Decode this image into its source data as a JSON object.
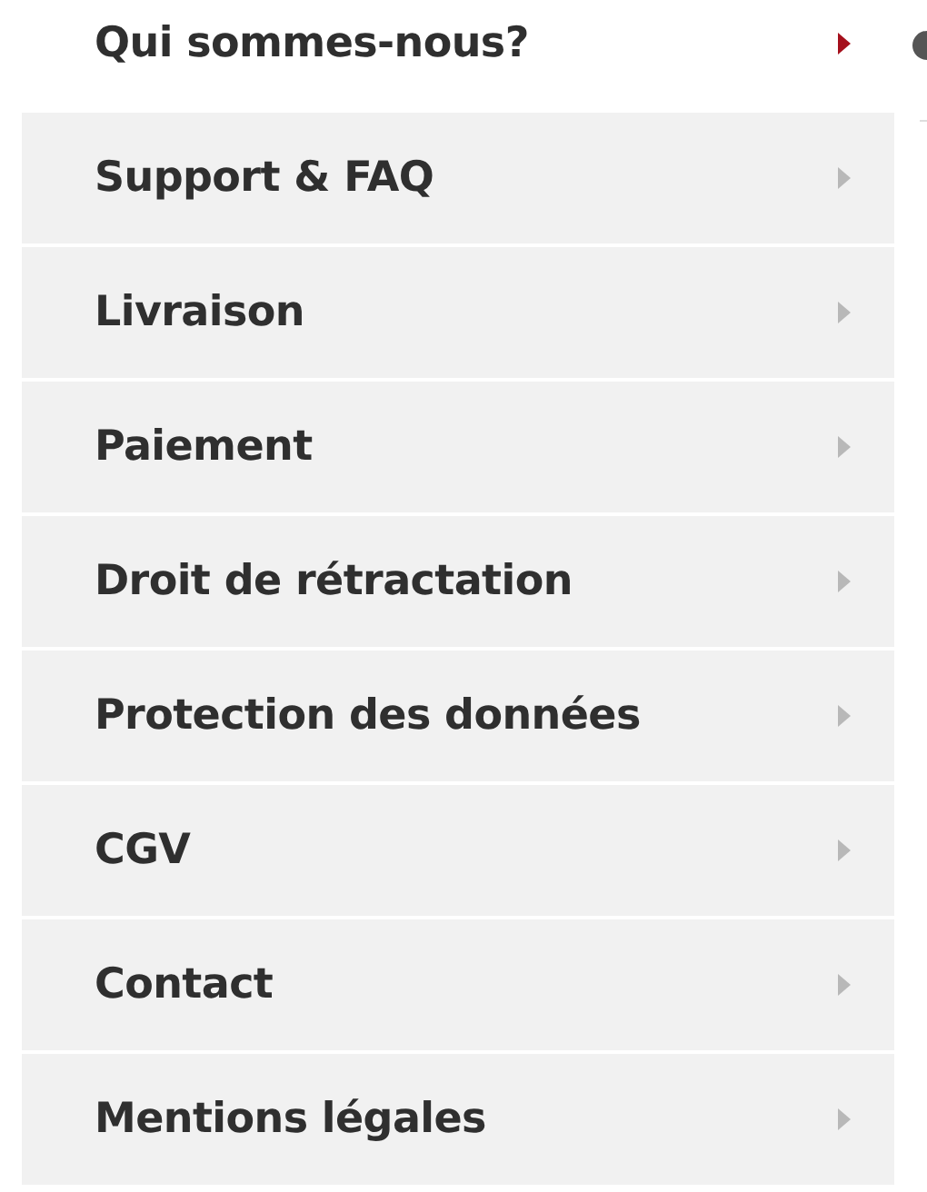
{
  "menu": [
    {
      "label": "Qui sommes-nous?",
      "selected": true
    },
    {
      "label": "Support & FAQ",
      "selected": false
    },
    {
      "label": "Livraison",
      "selected": false
    },
    {
      "label": "Paiement",
      "selected": false
    },
    {
      "label": "Droit de rétractation",
      "selected": false
    },
    {
      "label": "Protection des données",
      "selected": false
    },
    {
      "label": "CGV",
      "selected": false
    },
    {
      "label": "Contact",
      "selected": false
    },
    {
      "label": "Mentions légales",
      "selected": false
    }
  ]
}
